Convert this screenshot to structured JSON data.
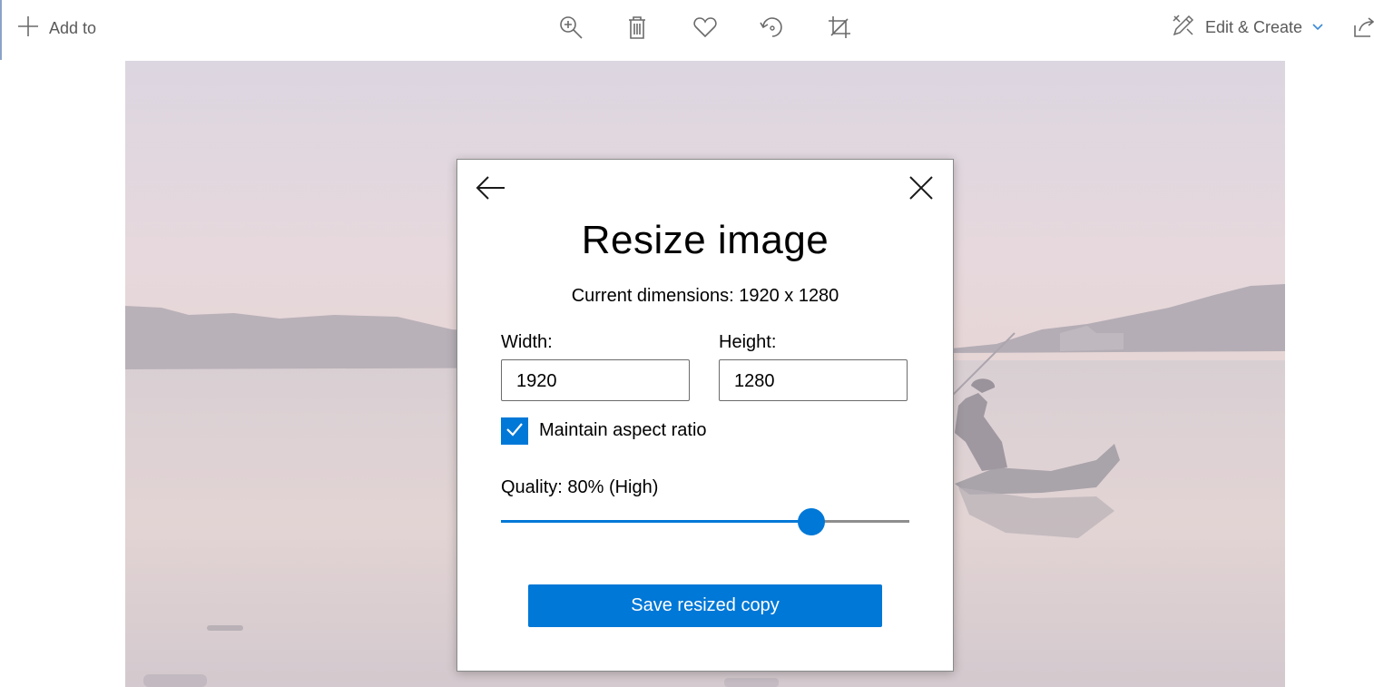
{
  "toolbar": {
    "add_to_label": "Add to",
    "icons": [
      "zoom-in-icon",
      "delete-icon",
      "favorite-icon",
      "rotate-icon",
      "crop-icon"
    ],
    "edit_create_label": "Edit & Create"
  },
  "dialog": {
    "title": "Resize image",
    "current_dimensions": "Current dimensions: 1920 x 1280",
    "width_label": "Width:",
    "width_value": "1920",
    "height_label": "Height:",
    "height_value": "1280",
    "aspect_label": "Maintain aspect ratio",
    "aspect_checked": true,
    "quality_label": "Quality: 80% (High)",
    "quality_value": 0.76,
    "save_label": "Save resized copy"
  },
  "colors": {
    "accent": "#0078d7"
  }
}
